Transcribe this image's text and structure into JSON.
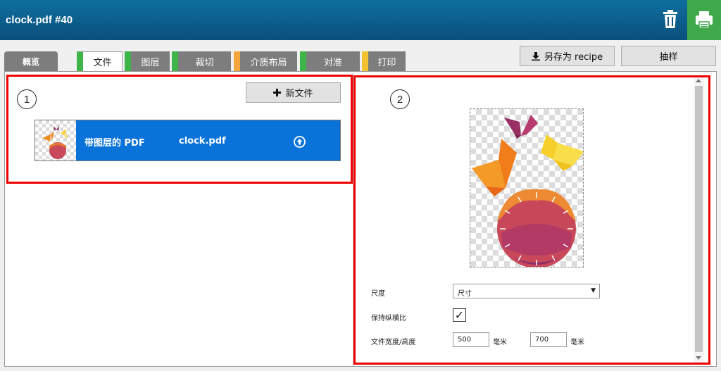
{
  "window": {
    "title": "clock.pdf #40"
  },
  "header_icons": {
    "delete": "trash-icon",
    "print": "printer-icon"
  },
  "tabs": {
    "overview": "概览",
    "items": [
      {
        "label": "文件",
        "color": "#3fb549",
        "active": true
      },
      {
        "label": "图层",
        "color": "#3fb549",
        "active": false
      },
      {
        "label": "裁切",
        "color": "#3fb549",
        "active": false
      },
      {
        "label": "介质布局",
        "color": "#f4a53c",
        "active": false
      },
      {
        "label": "对准",
        "color": "#3fb549",
        "active": false
      },
      {
        "label": "打印",
        "color": "#f2c230",
        "active": false
      }
    ]
  },
  "toolbar": {
    "save_recipe": "另存为 recipe",
    "sample": "抽样"
  },
  "callouts": {
    "left": "1",
    "right": "2"
  },
  "files": {
    "new_file": "新文件",
    "items": [
      {
        "type": "带图层的 PDF",
        "name": "clock.pdf"
      }
    ]
  },
  "settings": {
    "scale_label": "尺度",
    "scale_value": "尺寸",
    "keep_ratio_label": "保持纵横比",
    "keep_ratio_checked": true,
    "checkmark": "✓",
    "size_label": "文件宽度/高度",
    "width": "500",
    "height": "700",
    "unit": "毫米"
  },
  "colors": {
    "header": "#0a5a8a",
    "accent_green": "#3fa84b",
    "selection_blue": "#0a73d9",
    "callout_red": "#e00000"
  }
}
